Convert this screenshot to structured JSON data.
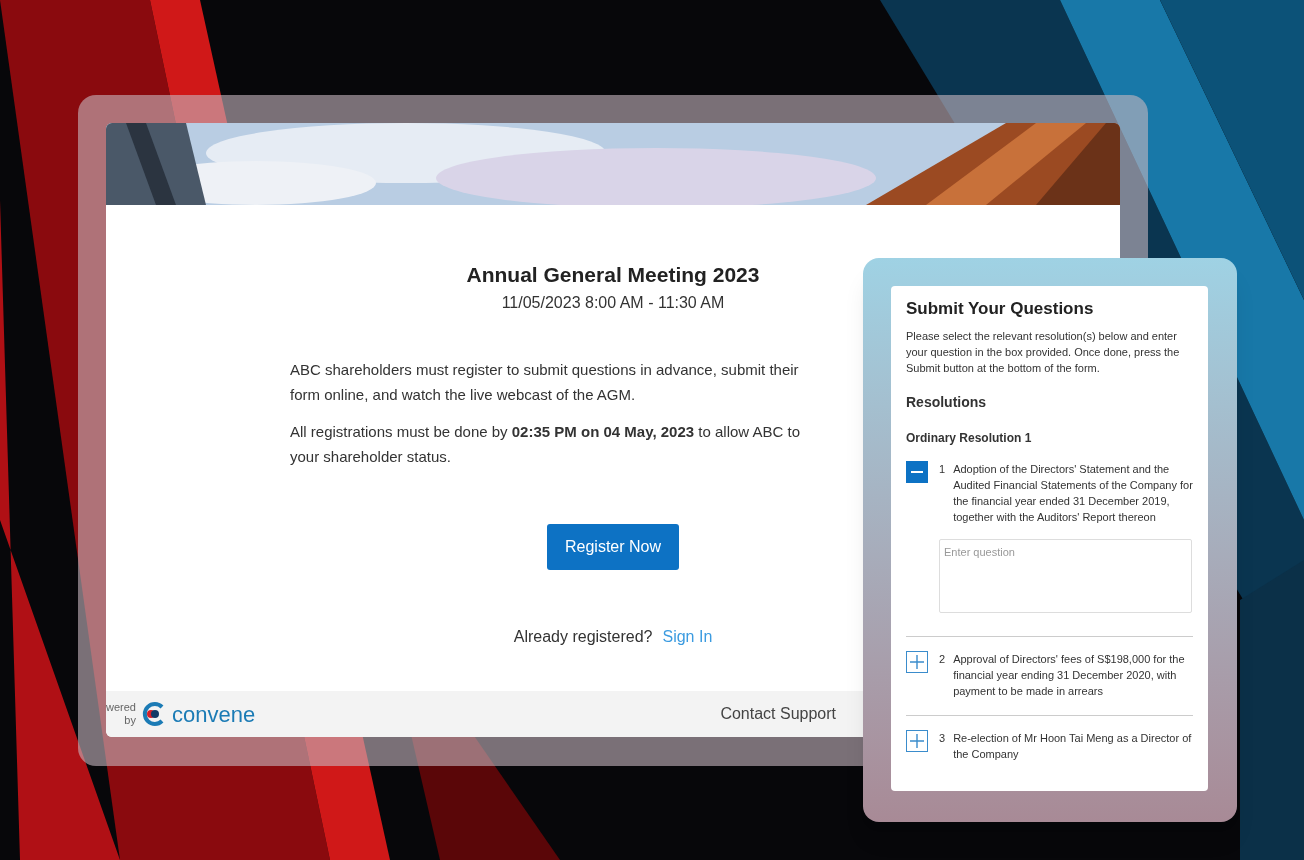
{
  "page": {
    "title": "Annual General Meeting 2023",
    "datetime": "11/05/2023 8:00 AM - 11:30 AM",
    "paragraphs": [
      {
        "lines": [
          "ABC shareholders must register to submit questions in advance, submit their",
          "form online, and watch the live webcast of the AGM."
        ]
      },
      {
        "lines": [
          "All registrations must be done by **02:35 PM on 04 May, 2023** to allow ABC to",
          "your shareholder status."
        ]
      }
    ],
    "register_button": "Register Now",
    "already_text": "Already registered?",
    "sign_in_link": "Sign In",
    "footer": {
      "powered_by_lines": [
        "wered",
        "by"
      ],
      "brand": "convene",
      "contact": "Contact Support"
    }
  },
  "questions_panel": {
    "title": "Submit Your Questions",
    "intro": "Please select the relevant resolution(s) below and enter your question in the box provided. Once done, press the Submit button at the bottom of the form.",
    "section": "Resolutions",
    "group": "Ordinary Resolution 1",
    "resolutions": [
      {
        "number": "1",
        "text": "Adoption of the Directors' Statement and the Audited Financial Statements of the Company for the financial year ended 31 December 2019, together with the Auditors' Report thereon",
        "expanded": true,
        "placeholder": "Enter question"
      },
      {
        "number": "2",
        "text": "Approval of Directors' fees of S$198,000 for the financial year ending 31 December 2020, with payment to be made in arrears",
        "expanded": false
      },
      {
        "number": "3",
        "text": "Re-election of Mr Hoon Tai Meng as a Director of the Company",
        "expanded": false
      }
    ]
  }
}
